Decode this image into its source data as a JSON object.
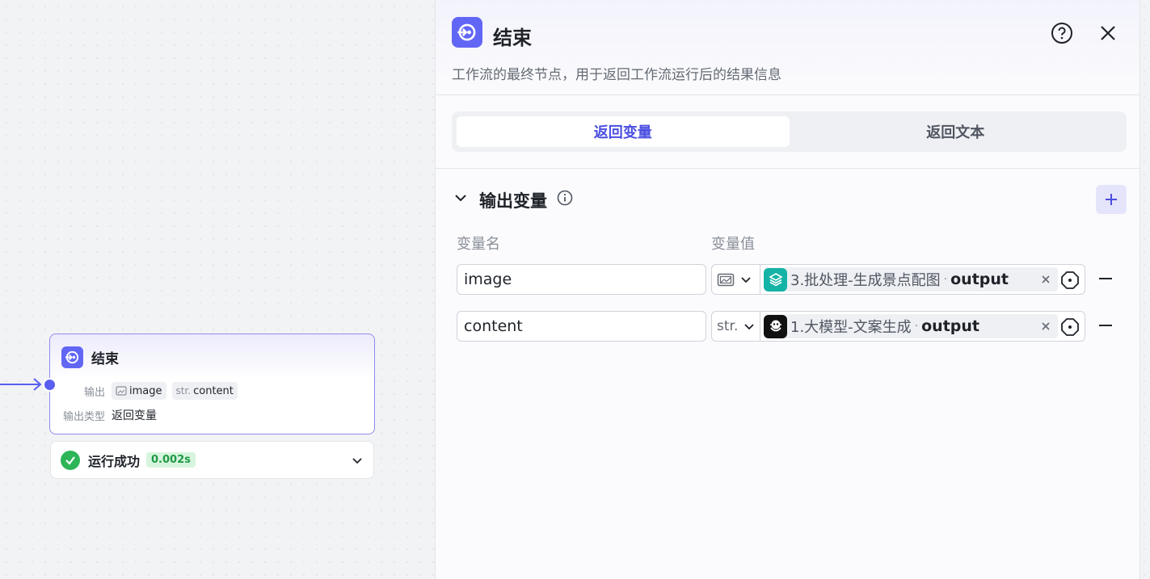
{
  "node": {
    "title": "结束",
    "output_label": "输出",
    "outputs": [
      {
        "type": "image-icon",
        "name": "image"
      },
      {
        "type": "str.",
        "name": "content"
      }
    ],
    "output_type_label": "输出类型",
    "output_type_value": "返回变量"
  },
  "status": {
    "text": "运行成功",
    "time": "0.002s"
  },
  "panel": {
    "title": "结束",
    "description": "工作流的最终节点，用于返回工作流运行后的结果信息",
    "tabs": [
      {
        "label": "返回变量",
        "active": true
      },
      {
        "label": "返回文本",
        "active": false
      }
    ],
    "section_title": "输出变量",
    "col_name": "变量名",
    "col_value": "变量值",
    "rows": [
      {
        "name": "image",
        "type": "image-icon",
        "ref_icon": "layers-icon",
        "ref_icon_color": "#14b3a6",
        "ref_node": "3.批处理-生成景点配图",
        "ref_var": "output"
      },
      {
        "name": "content",
        "type": "str.",
        "ref_icon": "llm-icon",
        "ref_icon_color": "#111111",
        "ref_node": "1.大模型-文案生成",
        "ref_var": "output"
      }
    ]
  },
  "colors": {
    "accent": "#6266f5",
    "success": "#2db558"
  }
}
